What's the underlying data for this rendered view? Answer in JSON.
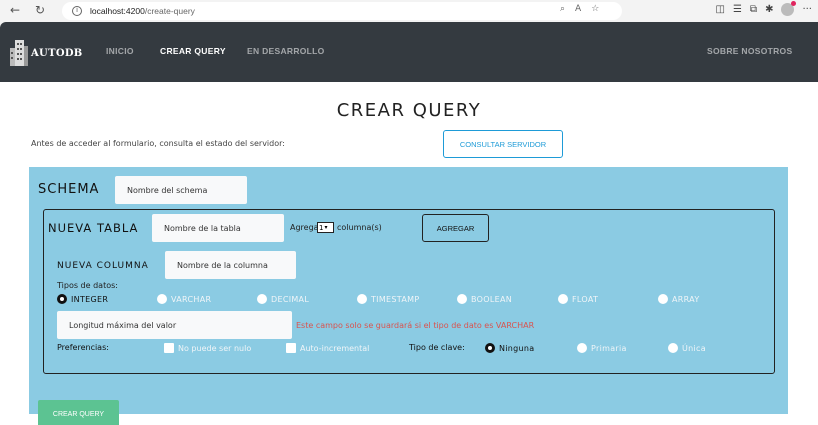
{
  "browser": {
    "url_host": "localhost:4200",
    "url_path": "/create-query"
  },
  "navbar": {
    "logo_text": "AUTODB",
    "links": [
      "INICIO",
      "CREAR QUERY",
      "EN DESARROLLO"
    ],
    "right_link": "SOBRE NOSOTROS"
  },
  "page": {
    "title": "CREAR QUERY",
    "server_text": "Antes de acceder al formulario, consulta el estado del servidor:",
    "server_button": "CONSULTAR SERVIDOR"
  },
  "schema": {
    "label": "SCHEMA",
    "placeholder": "Nombre del schema"
  },
  "tabla": {
    "label": "NUEVA TABLA",
    "placeholder": "Nombre de la tabla",
    "agregar_text": "Agregar",
    "select_value": "1",
    "columnas_text": "columna(s)",
    "agregar_button": "AGREGAR"
  },
  "columna": {
    "label": "NUEVA COLUMNA",
    "placeholder": "Nombre de la columna",
    "tipos_label": "Tipos de datos:",
    "tipos": [
      "INTEGER",
      "VARCHAR",
      "DECIMAL",
      "TIMESTAMP",
      "BOOLEAN",
      "FLOAT",
      "ARRAY"
    ],
    "longitud_placeholder": "Longitud máxima del valor",
    "warning": "Este campo solo se guardará si el tipo de dato es VARCHAR",
    "preferencias_label": "Preferencias:",
    "no_nulo": "No puede ser nulo",
    "auto_inc": "Auto-incremental",
    "tipo_clave_label": "Tipo de clave:",
    "claves": [
      "Ninguna",
      "Primaria",
      "Única"
    ]
  },
  "submit_button": "CREAR QUERY"
}
